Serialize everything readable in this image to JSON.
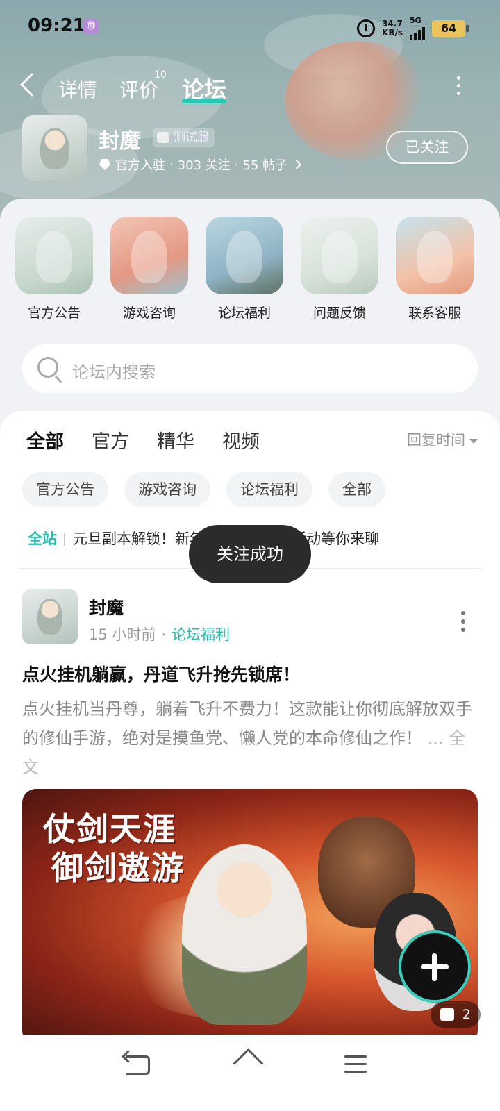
{
  "status": {
    "time": "09:21",
    "badge": "㉄",
    "net_speed_value": "34.7",
    "net_speed_unit": "KB/s",
    "network": "5G",
    "battery": "64"
  },
  "nav": {
    "tabs": [
      {
        "label": "详情"
      },
      {
        "label": "评价",
        "badge": "10"
      },
      {
        "label": "论坛"
      }
    ],
    "active_tab": "论坛"
  },
  "app": {
    "name": "封魔",
    "tag": "测试服",
    "verified": "官方入驻",
    "followers": "303 关注",
    "posts": "55 帖子",
    "sep": "·",
    "follow_button": "已关注"
  },
  "shortcuts": [
    {
      "label": "官方公告",
      "color": "#cfdcd2"
    },
    {
      "label": "游戏咨询",
      "color": "#e6a18d"
    },
    {
      "label": "论坛福利",
      "color": "#9ec0cf"
    },
    {
      "label": "问题反馈",
      "color": "#dfe7e2"
    },
    {
      "label": "联系客服",
      "color": "#efb89f"
    }
  ],
  "search": {
    "placeholder": "论坛内搜索"
  },
  "feed_tabs": [
    {
      "label": "全部"
    },
    {
      "label": "官方"
    },
    {
      "label": "精华"
    },
    {
      "label": "视频"
    }
  ],
  "sort_label": "回复时间",
  "chips": [
    {
      "label": "官方公告"
    },
    {
      "label": "游戏咨询"
    },
    {
      "label": "论坛福利"
    },
    {
      "label": "全部"
    }
  ],
  "notice": {
    "tag": "全站",
    "text": "元旦副本解锁！新年版本话题讨论活动等你来聊"
  },
  "toast": "关注成功",
  "post": {
    "author": "封魔",
    "time": "15 小时前",
    "dot": "·",
    "category": "论坛福利",
    "title": "点火挂机躺赢，丹道飞升抢先锁席！",
    "body": "点火挂机当丹尊，躺着飞升不费力！这款能让你彻底解放双手的修仙手游，绝对是摸鱼党、懒人党的本命修仙之作！",
    "more": "... 全文",
    "image_title_line1": "仗剑天涯",
    "image_title_line2": "御剑遨游",
    "image_count": "2"
  },
  "colors": {
    "accent": "#26c6b7"
  }
}
